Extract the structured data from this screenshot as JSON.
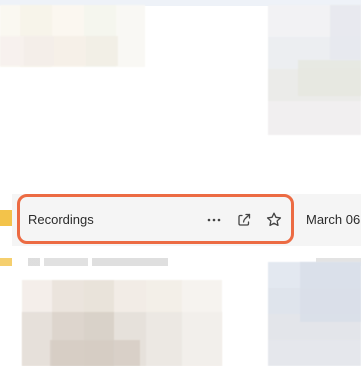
{
  "folder_row": {
    "name": "Recordings",
    "date": "March 06,",
    "icons": {
      "more": "more-options-icon",
      "share": "share-icon",
      "favorite": "star-icon"
    }
  },
  "colors": {
    "selection_outline": "#ec6b43",
    "folder_accent": "#f3c34a",
    "row_hover": "#f5f5f5"
  }
}
